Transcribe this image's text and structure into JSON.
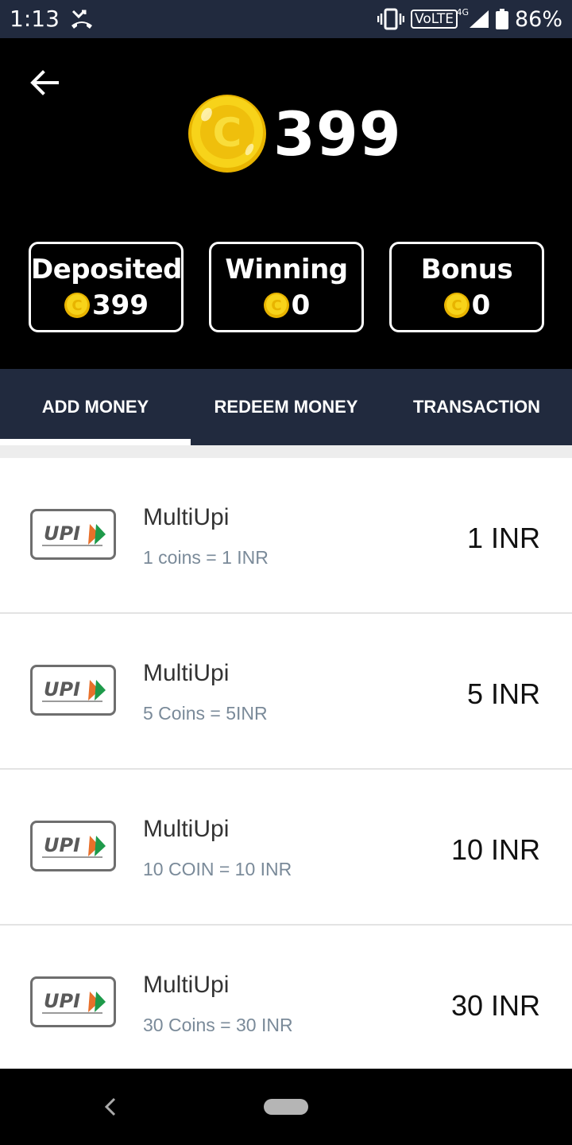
{
  "status_bar": {
    "time": "1:13",
    "volte": "VoLTE",
    "network": "4G",
    "battery": "86%"
  },
  "balance": {
    "total": "399"
  },
  "wallet_cards": [
    {
      "title": "Deposited",
      "value": "399"
    },
    {
      "title": "Winning",
      "value": "0"
    },
    {
      "title": "Bonus",
      "value": "0"
    }
  ],
  "tabs": [
    {
      "label": "ADD MONEY",
      "active": true
    },
    {
      "label": "REDEEM MONEY",
      "active": false
    },
    {
      "label": "TRANSACTION",
      "active": false
    }
  ],
  "packages": [
    {
      "title": "MultiUpi",
      "subtitle": "1 coins = 1 INR",
      "amount": "1 INR"
    },
    {
      "title": "MultiUpi",
      "subtitle": "5 Coins = 5INR",
      "amount": "5 INR"
    },
    {
      "title": "MultiUpi",
      "subtitle": "10 COIN = 10 INR",
      "amount": "10 INR"
    },
    {
      "title": "MultiUpi",
      "subtitle": "30 Coins = 30 INR",
      "amount": "30 INR"
    }
  ],
  "upi_logo_text": "UPI",
  "colors": {
    "header_bg": "#000000",
    "tab_bar_bg": "#212a3e",
    "coin_gold": "#f5c518",
    "subtitle_gray": "#7a8a99"
  }
}
